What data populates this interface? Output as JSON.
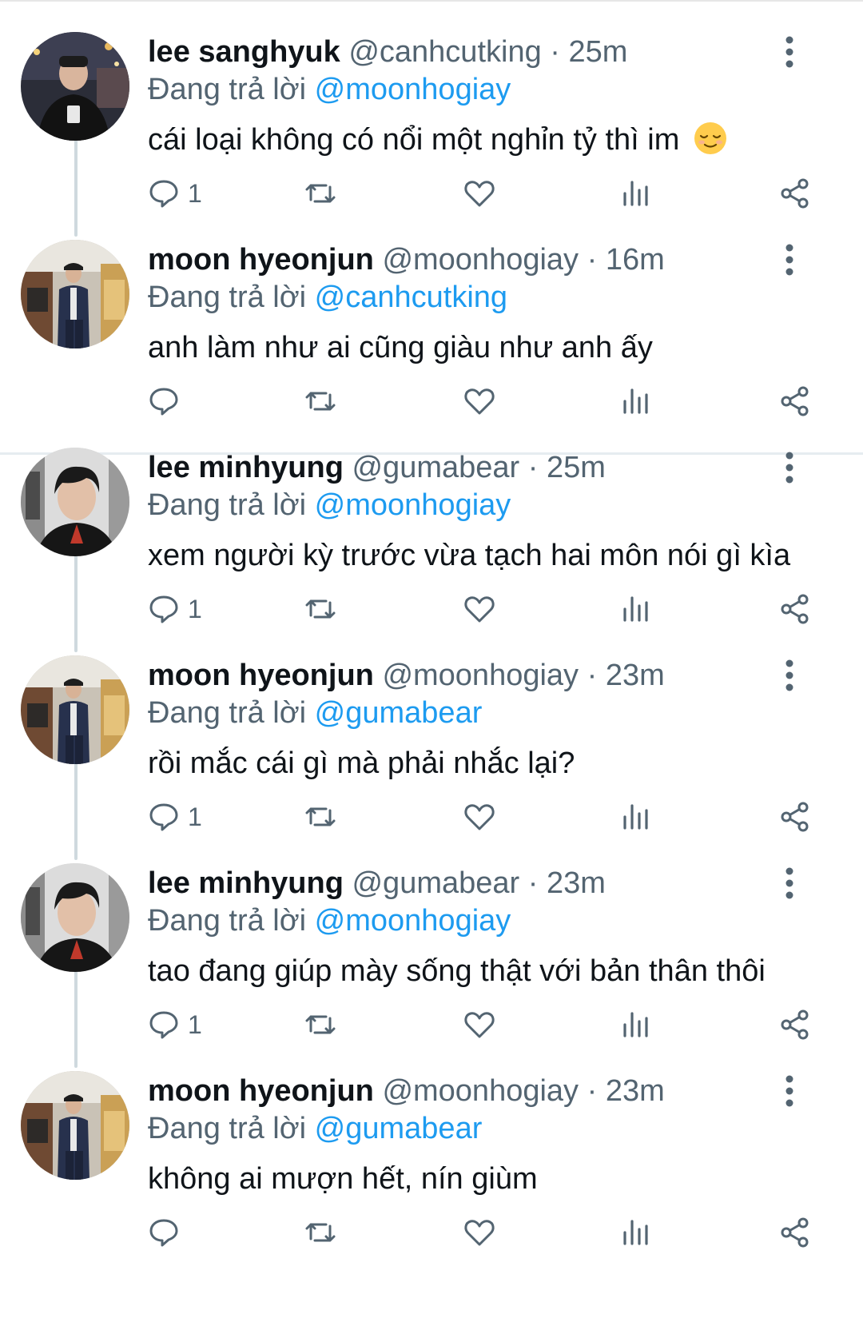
{
  "replying_prefix": "Đang trả lời",
  "threads": [
    {
      "tweets": [
        {
          "name": "lee sanghyuk",
          "handle": "@canhcutking",
          "time": "25m",
          "reply_to": "@moonhogiay",
          "text": "cái loại không có nổi một nghỉn tỷ thì im",
          "emoji": "relieved-face",
          "reply_count": "1",
          "avatar": "person-avatar-night-street"
        },
        {
          "name": "moon hyeonjun",
          "handle": "@moonhogiay",
          "time": "16m",
          "reply_to": "@canhcutking",
          "text": "anh làm như ai cũng giàu như anh ấy",
          "reply_count": "",
          "avatar": "person-avatar-suit-street"
        }
      ]
    },
    {
      "tweets": [
        {
          "name": "lee minhyung",
          "handle": "@gumabear",
          "time": "25m",
          "reply_to": "@moonhogiay",
          "text": "xem người kỳ trước vừa tạch hai môn nói gì kìa",
          "reply_count": "1",
          "avatar": "person-avatar-portrait"
        },
        {
          "name": "moon hyeonjun",
          "handle": "@moonhogiay",
          "time": "23m",
          "reply_to": "@gumabear",
          "text": "rồi mắc cái gì mà phải nhắc lại?",
          "reply_count": "1",
          "avatar": "person-avatar-suit-street"
        },
        {
          "name": "lee minhyung",
          "handle": "@gumabear",
          "time": "23m",
          "reply_to": "@moonhogiay",
          "text": "tao đang giúp mày sống thật với bản thân thôi",
          "reply_count": "1",
          "avatar": "person-avatar-portrait"
        },
        {
          "name": "moon hyeonjun",
          "handle": "@moonhogiay",
          "time": "23m",
          "reply_to": "@gumabear",
          "text": "không ai mượn hết, nín giùm",
          "reply_count": "",
          "avatar": "person-avatar-suit-street"
        }
      ]
    }
  ],
  "colors": {
    "text": "#0f1419",
    "secondary": "#536471",
    "mention": "#1d9bf0",
    "connector": "#cfd9de",
    "divider": "#e6ecf0"
  }
}
